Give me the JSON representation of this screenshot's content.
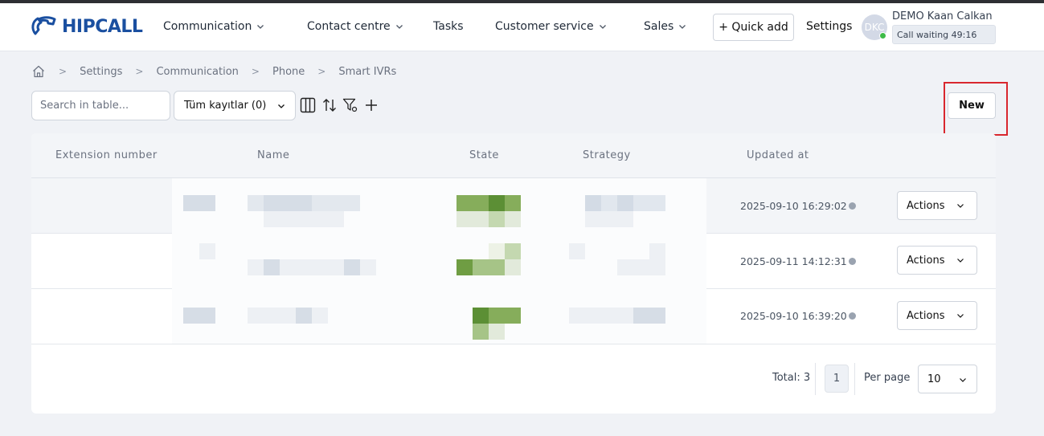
{
  "brand": {
    "name": "HIPCALL",
    "accent": "#1a4fa0"
  },
  "nav": {
    "items": [
      {
        "label": "Communication",
        "dropdown": true
      },
      {
        "label": "Contact centre",
        "dropdown": true
      },
      {
        "label": "Tasks",
        "dropdown": false
      },
      {
        "label": "Customer service",
        "dropdown": true
      },
      {
        "label": "Sales",
        "dropdown": true
      }
    ],
    "quick_add": "+ Quick add",
    "settings": "Settings"
  },
  "user": {
    "initials": "DKC",
    "name": "DEMO Kaan Calkan",
    "status": "Call waiting 49:16",
    "status_color": "#3dbb47"
  },
  "breadcrumb": [
    "Settings",
    "Communication",
    "Phone",
    "Smart IVRs"
  ],
  "toolbar": {
    "search_placeholder": "Search in table...",
    "filter_value": "Tüm kayıtlar (0)",
    "icons": [
      "columns-icon",
      "sort-icon",
      "filter-settings-icon",
      "plus-icon"
    ],
    "new_label": "New"
  },
  "table": {
    "columns": [
      "Extension number",
      "Name",
      "State",
      "Strategy",
      "Updated at"
    ],
    "rows": [
      {
        "updated_at": "2025-09-10 16:29:02",
        "action_label": "Actions"
      },
      {
        "updated_at": "2025-09-11 14:12:31",
        "action_label": "Actions"
      },
      {
        "updated_at": "2025-09-10 16:39:20",
        "action_label": "Actions"
      }
    ]
  },
  "pagination": {
    "total_label": "Total: 3",
    "current_page": "1",
    "per_page_label": "Per page",
    "per_page_value": "10"
  }
}
